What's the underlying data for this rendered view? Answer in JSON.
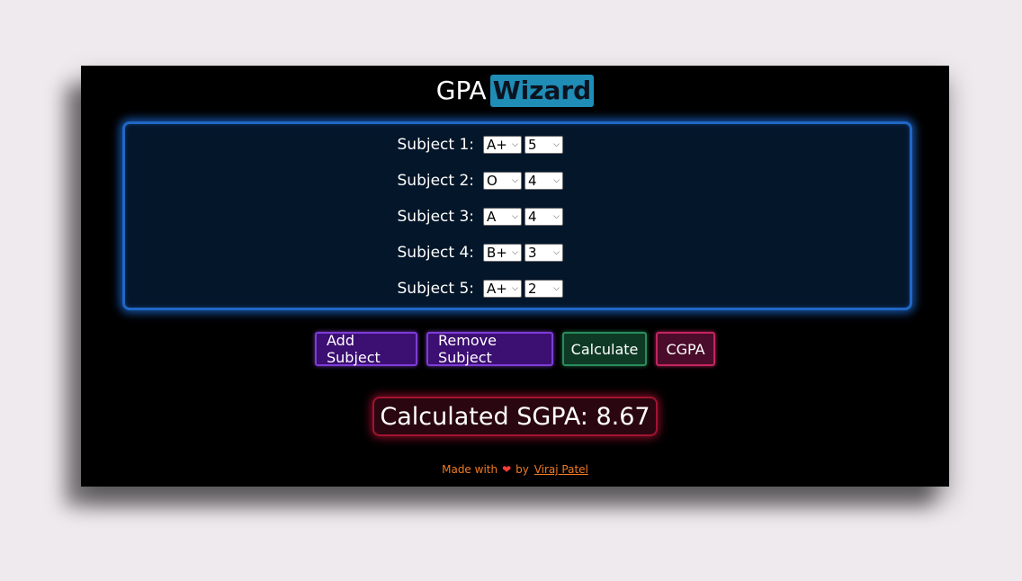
{
  "title": {
    "prefix": "GPA",
    "brand": "Wizard"
  },
  "subjects": [
    {
      "label": "Subject 1:",
      "grade": "A+",
      "credits": "5"
    },
    {
      "label": "Subject 2:",
      "grade": "O",
      "credits": "4"
    },
    {
      "label": "Subject 3:",
      "grade": "A",
      "credits": "4"
    },
    {
      "label": "Subject 4:",
      "grade": "B+",
      "credits": "3"
    },
    {
      "label": "Subject 5:",
      "grade": "A+",
      "credits": "2"
    }
  ],
  "buttons": {
    "add_subject": "Add Subject",
    "remove_subject": "Remove Subject",
    "calculate": "Calculate",
    "cgpa": "CGPA"
  },
  "result": {
    "text": "Calculated SGPA: 8.67"
  },
  "footer": {
    "made_with": "Made with",
    "heart_icon": "heart-icon",
    "by": "by",
    "author": "Viraj Patel"
  },
  "colors": {
    "page_background": "#efeaee",
    "app_background": "#000000",
    "brand_highlight": "#1f8db5",
    "panel_glow": "#1f67c4",
    "purple_button": "#7d3cd6",
    "green_button": "#2a8c5c",
    "pink_button": "#c2255e",
    "result_glow": "#a01430",
    "footer_text": "#f07a22"
  }
}
